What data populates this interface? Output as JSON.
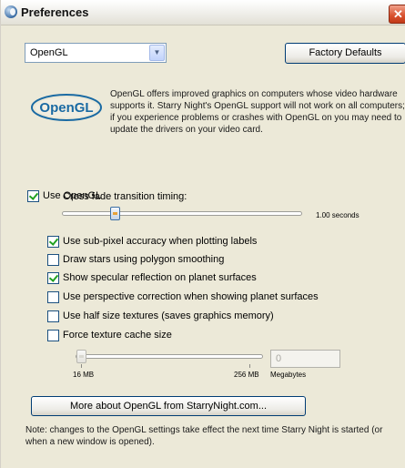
{
  "window": {
    "title": "Preferences",
    "close_symbol": "✕"
  },
  "renderer_select": {
    "value": "OpenGL",
    "arrow_symbol": "▼"
  },
  "factory_defaults_label": "Factory Defaults",
  "logo": {
    "text": "OpenGL"
  },
  "intro_text": "OpenGL offers improved graphics on computers whose video hardware supports it. Starry Night's OpenGL support will not work on all computers; if you experience problems or crashes with OpenGL on you may need to update the drivers on your video card.",
  "use_opengl": {
    "label": "Use OpenGL",
    "checked": true
  },
  "cross_fade": {
    "label": "Cross fade transition timing:",
    "value_seconds": 1.0,
    "value_text": "1.00 seconds"
  },
  "options": [
    {
      "label": "Use sub-pixel accuracy when plotting labels",
      "checked": true
    },
    {
      "label": "Draw stars using polygon smoothing",
      "checked": false
    },
    {
      "label": "Show specular reflection on planet surfaces",
      "checked": true
    },
    {
      "label": "Use perspective correction when showing planet surfaces",
      "checked": false
    },
    {
      "label": "Use half size textures (saves graphics memory)",
      "checked": false
    },
    {
      "label": "Force texture cache size",
      "checked": false
    }
  ],
  "texture_cache": {
    "min_label": "16 MB",
    "max_label": "256 MB",
    "unit_label": "Megabytes",
    "value": "0",
    "slider_value_mb": 16
  },
  "more_button_label": "More about OpenGL from StarryNight.com...",
  "note": "Note: changes to the OpenGL settings take effect the next time Starry Night is started (or when a new window is opened).",
  "colors": {
    "title_close": "#d8502d",
    "checkmark": "#21a121",
    "logo_text": "#1a6aa3",
    "button_border": "#003c74"
  }
}
